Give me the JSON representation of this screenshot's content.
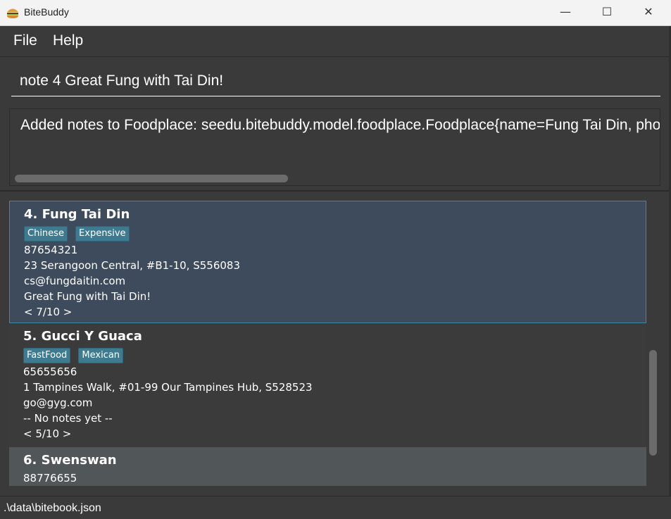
{
  "window": {
    "title": "BiteBuddy",
    "icon": "burger-icon",
    "controls": {
      "minimize": "—",
      "maximize": "☐",
      "close": "✕"
    }
  },
  "menu": {
    "file": "File",
    "help": "Help"
  },
  "command": {
    "value": "note 4 Great Fung with Tai Din!"
  },
  "result": {
    "text": "Added notes to Foodplace: seedu.bitebuddy.model.foodplace.Foodplace{name=Fung Tai Din, phone"
  },
  "foodplaces": [
    {
      "name": "4. Fung Tai Din",
      "tags": [
        "Chinese",
        "Expensive"
      ],
      "phone": "87654321",
      "address": "23 Serangoon Central, #B1-10, S556083",
      "email": "cs@fungdaitin.com",
      "note": "Great Fung with Tai Din!",
      "rating": "< 7/10 >"
    },
    {
      "name": "5. Gucci Y Guaca",
      "tags": [
        "FastFood",
        "Mexican"
      ],
      "phone": "65655656",
      "address": "1 Tampines Walk, #01-99 Our Tampines Hub, S528523",
      "email": "go@gyg.com",
      "note": "-- No notes yet --",
      "rating": "< 5/10 >"
    },
    {
      "name": "6. Swenswan",
      "phone": "88776655"
    }
  ],
  "status": {
    "path": ".\\data\\bitebook.json"
  },
  "colors": {
    "accent": "#3e7b91",
    "selected_card": "#3e4b5d",
    "background": "#3a3a3a"
  }
}
